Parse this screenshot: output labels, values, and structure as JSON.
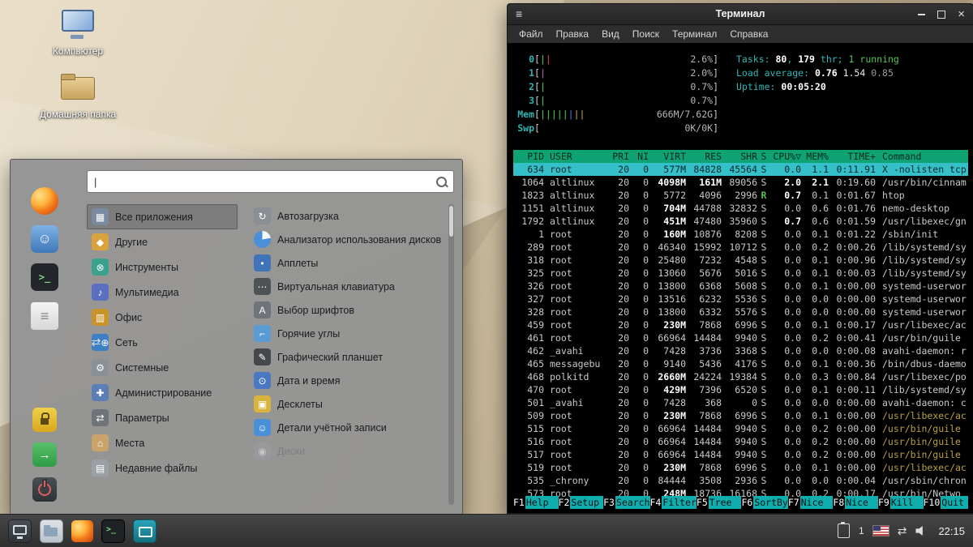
{
  "desktop": {
    "icons": [
      {
        "name": "computer-icon",
        "label": "Компьютер"
      },
      {
        "name": "home-folder-icon",
        "label": "Домашняя папка"
      }
    ]
  },
  "menu": {
    "search_placeholder": "",
    "favorites": [
      {
        "name": "firefox-icon"
      },
      {
        "name": "contacts-icon"
      },
      {
        "name": "terminal-icon"
      },
      {
        "name": "text-editor-icon"
      }
    ],
    "session": [
      {
        "name": "lock-screen-icon"
      },
      {
        "name": "logout-icon"
      },
      {
        "name": "shutdown-icon"
      }
    ],
    "categories": [
      {
        "name": "all-applications",
        "label": "Все приложения",
        "color": "#7a8aa0",
        "glyph": "▦",
        "selected": true
      },
      {
        "name": "other",
        "label": "Другие",
        "color": "#d9a23c",
        "glyph": "◆"
      },
      {
        "name": "tools",
        "label": "Инструменты",
        "color": "#3aa18c",
        "glyph": "⊗"
      },
      {
        "name": "multimedia",
        "label": "Мультимедиа",
        "color": "#5a6fc0",
        "glyph": "♪"
      },
      {
        "name": "office",
        "label": "Офис",
        "color": "#c8942a",
        "glyph": "▥"
      },
      {
        "name": "network",
        "label": "Сеть",
        "color": "#3d7fc4",
        "glyph": "⊕"
      },
      {
        "name": "system",
        "label": "Системные",
        "color": "#8a9097",
        "glyph": "⚙"
      },
      {
        "name": "administration",
        "label": "Администрирование",
        "color": "#5b7fb4",
        "glyph": "✚"
      },
      {
        "name": "preferences",
        "label": "Параметры",
        "color": "#6e7479",
        "glyph": "⇄"
      },
      {
        "name": "places",
        "label": "Места",
        "color": "#c9a36a",
        "glyph": "⌂"
      },
      {
        "name": "recent-files",
        "label": "Недавние файлы",
        "color": "#9aa0a6",
        "glyph": "▤"
      }
    ],
    "applications": [
      {
        "name": "startup-applications",
        "label": "Автозагрузка",
        "color": "#8a8f95",
        "glyph": "↻"
      },
      {
        "name": "disk-usage-analyzer",
        "label": "Анализатор использования дисков",
        "color": "",
        "glyph": ""
      },
      {
        "name": "applets",
        "label": "Апплеты",
        "color": "#3f74b8",
        "glyph": "•"
      },
      {
        "name": "virtual-keyboard",
        "label": "Виртуальная клавиатура",
        "color": "#4d5257",
        "glyph": "⋯"
      },
      {
        "name": "font-selection",
        "label": "Выбор шрифтов",
        "color": "#6f747a",
        "glyph": "A"
      },
      {
        "name": "hot-corners",
        "label": "Горячие углы",
        "color": "#5a9bd4",
        "glyph": "⌐"
      },
      {
        "name": "graphics-tablet",
        "label": "Графический планшет",
        "color": "#44484d",
        "glyph": "✎"
      },
      {
        "name": "date-time",
        "label": "Дата и время",
        "color": "#4a78c2",
        "glyph": "⊙"
      },
      {
        "name": "desklets",
        "label": "Десклеты",
        "color": "#d9b43c",
        "glyph": "▣"
      },
      {
        "name": "account-details",
        "label": "Детали учётной записи",
        "color": "#4a90d9",
        "glyph": "☺"
      },
      {
        "name": "disks",
        "label": "Диски",
        "color": "#9aa0a6",
        "glyph": "◉",
        "disabled": true
      }
    ]
  },
  "terminal": {
    "title": "Терминал",
    "menu_items": [
      "Файл",
      "Правка",
      "Вид",
      "Поиск",
      "Терминал",
      "Справка"
    ],
    "htop": {
      "meters": [
        {
          "label": "0",
          "pipes": [
            "green",
            "red"
          ],
          "value": "2.6%"
        },
        {
          "label": "1",
          "pipes": [
            "magenta"
          ],
          "value": "2.0%"
        },
        {
          "label": "2",
          "pipes": [
            "green"
          ],
          "value": "0.7%"
        },
        {
          "label": "3",
          "pipes": [
            "green"
          ],
          "value": "0.7%"
        },
        {
          "label": "Mem",
          "pipes": [
            "green",
            "green",
            "green",
            "green",
            "green",
            "blue",
            "yellow",
            "yellow"
          ],
          "value": "666M/7.62G"
        },
        {
          "label": "Swp",
          "pipes": [],
          "value": "0K/0K"
        }
      ],
      "info_lines": [
        {
          "name": "tasks-line",
          "segments": [
            {
              "t": "Tasks: ",
              "c": "cyan"
            },
            {
              "t": "80",
              "c": "bw"
            },
            {
              "t": ", ",
              "c": "cyan"
            },
            {
              "t": "179",
              "c": "bw"
            },
            {
              "t": " thr",
              "c": "cyan"
            },
            {
              "t": "; ",
              "c": "cyan"
            },
            {
              "t": "1",
              "c": "grn"
            },
            {
              "t": " running",
              "c": "grn"
            }
          ]
        },
        {
          "name": "load-line",
          "segments": [
            {
              "t": "Load average: ",
              "c": "cyan"
            },
            {
              "t": "0.76 ",
              "c": "bw"
            },
            {
              "t": "1.54 ",
              "c": "w"
            },
            {
              "t": "0.85",
              "c": "gry"
            }
          ]
        },
        {
          "name": "uptime-line",
          "segments": [
            {
              "t": "Uptime: ",
              "c": "cyan"
            },
            {
              "t": "00:05:20",
              "c": "bw"
            }
          ]
        }
      ],
      "columns": [
        "PID",
        "USER",
        "PRI",
        "NI",
        "VIRT",
        "RES",
        "SHR",
        "S",
        "CPU%▽",
        "MEM%",
        "TIME+",
        "Command"
      ],
      "rows": [
        {
          "cells": [
            "634",
            "root",
            "20",
            "0",
            "577M",
            "84828",
            "45564",
            "S",
            "0.0",
            "1.1",
            "0:11.91",
            "X -nolisten tcp"
          ],
          "selected": true
        },
        {
          "cells": [
            "1064",
            "altlinux",
            "20",
            "0",
            "4098M",
            "161M",
            "89056",
            "S",
            "2.0",
            "2.1",
            "0:19.60",
            "/usr/bin/cinnam"
          ]
        },
        {
          "cells": [
            "1823",
            "altlinux",
            "20",
            "0",
            "5772",
            "4096",
            "2996",
            "R",
            "0.7",
            "0.1",
            "0:01.67",
            "htop"
          ]
        },
        {
          "cells": [
            "1151",
            "altlinux",
            "20",
            "0",
            "704M",
            "44788",
            "32832",
            "S",
            "0.0",
            "0.6",
            "0:01.76",
            "nemo-desktop"
          ]
        },
        {
          "cells": [
            "1792",
            "altlinux",
            "20",
            "0",
            "451M",
            "47480",
            "35960",
            "S",
            "0.7",
            "0.6",
            "0:01.59",
            "/usr/libexec/gn"
          ]
        },
        {
          "cells": [
            "1",
            "root",
            "20",
            "0",
            "160M",
            "10876",
            "8208",
            "S",
            "0.0",
            "0.1",
            "0:01.22",
            "/sbin/init"
          ]
        },
        {
          "cells": [
            "289",
            "root",
            "20",
            "0",
            "46340",
            "15992",
            "10712",
            "S",
            "0.0",
            "0.2",
            "0:00.26",
            "/lib/systemd/sy"
          ]
        },
        {
          "cells": [
            "318",
            "root",
            "20",
            "0",
            "25480",
            "7232",
            "4548",
            "S",
            "0.0",
            "0.1",
            "0:00.96",
            "/lib/systemd/sy"
          ]
        },
        {
          "cells": [
            "325",
            "root",
            "20",
            "0",
            "13060",
            "5676",
            "5016",
            "S",
            "0.0",
            "0.1",
            "0:00.03",
            "/lib/systemd/sy"
          ]
        },
        {
          "cells": [
            "326",
            "root",
            "20",
            "0",
            "13800",
            "6368",
            "5608",
            "S",
            "0.0",
            "0.1",
            "0:00.00",
            "systemd-userwor"
          ]
        },
        {
          "cells": [
            "327",
            "root",
            "20",
            "0",
            "13516",
            "6232",
            "5536",
            "S",
            "0.0",
            "0.0",
            "0:00.00",
            "systemd-userwor"
          ]
        },
        {
          "cells": [
            "328",
            "root",
            "20",
            "0",
            "13800",
            "6332",
            "5576",
            "S",
            "0.0",
            "0.0",
            "0:00.00",
            "systemd-userwor"
          ]
        },
        {
          "cells": [
            "459",
            "root",
            "20",
            "0",
            "230M",
            "7868",
            "6996",
            "S",
            "0.0",
            "0.1",
            "0:00.17",
            "/usr/libexec/ac"
          ]
        },
        {
          "cells": [
            "461",
            "root",
            "20",
            "0",
            "66964",
            "14484",
            "9940",
            "S",
            "0.0",
            "0.2",
            "0:00.41",
            "/usr/bin/guile"
          ]
        },
        {
          "cells": [
            "462",
            "_avahi",
            "20",
            "0",
            "7428",
            "3736",
            "3368",
            "S",
            "0.0",
            "0.0",
            "0:00.08",
            "avahi-daemon: r"
          ]
        },
        {
          "cells": [
            "465",
            "messagebu",
            "20",
            "0",
            "9140",
            "5436",
            "4176",
            "S",
            "0.0",
            "0.1",
            "0:00.36",
            "/bin/dbus-daemo"
          ]
        },
        {
          "cells": [
            "468",
            "polkitd",
            "20",
            "0",
            "2660M",
            "24224",
            "19384",
            "S",
            "0.0",
            "0.3",
            "0:00.84",
            "/usr/libexec/po"
          ]
        },
        {
          "cells": [
            "470",
            "root",
            "20",
            "0",
            "429M",
            "7396",
            "6520",
            "S",
            "0.0",
            "0.1",
            "0:00.11",
            "/lib/systemd/sy"
          ]
        },
        {
          "cells": [
            "501",
            "_avahi",
            "20",
            "0",
            "7428",
            "368",
            "0",
            "S",
            "0.0",
            "0.0",
            "0:00.00",
            "avahi-daemon: c"
          ]
        },
        {
          "cells": [
            "509",
            "root",
            "20",
            "0",
            "230M",
            "7868",
            "6996",
            "S",
            "0.0",
            "0.1",
            "0:00.00",
            "/usr/libexec/ac"
          ],
          "cmd_alt": true
        },
        {
          "cells": [
            "515",
            "root",
            "20",
            "0",
            "66964",
            "14484",
            "9940",
            "S",
            "0.0",
            "0.2",
            "0:00.00",
            "/usr/bin/guile"
          ],
          "cmd_alt": true
        },
        {
          "cells": [
            "516",
            "root",
            "20",
            "0",
            "66964",
            "14484",
            "9940",
            "S",
            "0.0",
            "0.2",
            "0:00.00",
            "/usr/bin/guile"
          ],
          "cmd_alt": true
        },
        {
          "cells": [
            "517",
            "root",
            "20",
            "0",
            "66964",
            "14484",
            "9940",
            "S",
            "0.0",
            "0.2",
            "0:00.00",
            "/usr/bin/guile"
          ],
          "cmd_alt": true
        },
        {
          "cells": [
            "519",
            "root",
            "20",
            "0",
            "230M",
            "7868",
            "6996",
            "S",
            "0.0",
            "0.1",
            "0:00.00",
            "/usr/libexec/ac"
          ],
          "cmd_alt": true
        },
        {
          "cells": [
            "535",
            "_chrony",
            "20",
            "0",
            "84444",
            "3508",
            "2936",
            "S",
            "0.0",
            "0.0",
            "0:00.04",
            "/usr/sbin/chron"
          ]
        },
        {
          "cells": [
            "573",
            "root",
            "20",
            "0",
            "248M",
            "18736",
            "16168",
            "S",
            "0.0",
            "0.2",
            "0:00.17",
            "/usr/bin/Netwo"
          ]
        }
      ],
      "fkeys": [
        [
          "F1",
          "Help"
        ],
        [
          "F2",
          "Setup"
        ],
        [
          "F3",
          "Search"
        ],
        [
          "F4",
          "Filter"
        ],
        [
          "F5",
          "Tree"
        ],
        [
          "F6",
          "SortBy"
        ],
        [
          "F7",
          "Nice -"
        ],
        [
          "F8",
          "Nice +"
        ],
        [
          "F9",
          "Kill"
        ],
        [
          "F10",
          "Quit"
        ]
      ]
    }
  },
  "taskbar": {
    "launchers": [
      {
        "name": "menu-button"
      },
      {
        "name": "files-launcher"
      },
      {
        "name": "firefox-launcher"
      },
      {
        "name": "terminal-launcher"
      },
      {
        "name": "screenshot-launcher"
      }
    ],
    "tray": [
      {
        "name": "clipboard-icon"
      },
      {
        "name": "notification-number",
        "text": "1"
      },
      {
        "name": "keyboard-layout-flag"
      },
      {
        "name": "network-icon"
      },
      {
        "name": "volume-icon"
      }
    ],
    "clock": "22:15"
  },
  "colors": {
    "header_green": "#0fa374",
    "selection_cyan": "#35bfc9",
    "fnkey_cyan": "#0fadad",
    "terminal_bg": "#000000"
  }
}
